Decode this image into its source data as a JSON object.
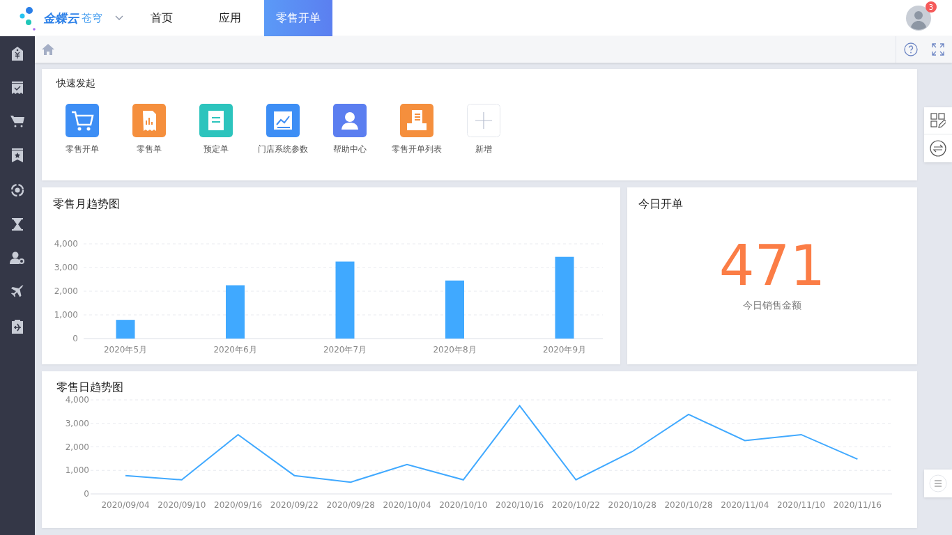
{
  "header": {
    "brand": "金蝶云",
    "brand_sub": "苍穹",
    "nav": [
      {
        "label": "首页",
        "selected": false
      },
      {
        "label": "应用",
        "selected": false
      },
      {
        "label": "零售开单",
        "selected": true
      }
    ],
    "notification_count": "3"
  },
  "quick_start": {
    "title": "快速发起",
    "items": [
      {
        "kind": "app",
        "label": "零售开单",
        "color": "#3d8ef5"
      },
      {
        "kind": "app",
        "label": "零售单",
        "color": "#f58f3d"
      },
      {
        "kind": "app",
        "label": "预定单",
        "color": "#2cc4bd"
      },
      {
        "kind": "app",
        "label": "门店系统参数",
        "color": "#3d8ef5"
      },
      {
        "kind": "app",
        "label": "帮助中心",
        "color": "#5b7ef0"
      },
      {
        "kind": "app",
        "label": "零售开单列表",
        "color": "#f58f3d"
      },
      {
        "kind": "add",
        "label": "新增"
      }
    ]
  },
  "monthly": {
    "title": "零售月趋势图",
    "chart_data": {
      "type": "bar",
      "categories": [
        "2020年5月",
        "2020年6月",
        "2020年7月",
        "2020年8月",
        "2020年9月"
      ],
      "series": [
        {
          "color": "#40a9ff",
          "values": [
            790,
            2250,
            3250,
            2450,
            3450
          ]
        }
      ],
      "grid": true,
      "ylim": [
        0,
        4000
      ],
      "yticks": [
        {
          "value": 0,
          "label": "0"
        },
        {
          "value": 1000,
          "label": "1,000"
        },
        {
          "value": 2000,
          "label": "2,000"
        },
        {
          "value": 3000,
          "label": "3,000"
        },
        {
          "value": 4000,
          "label": "4,000"
        }
      ]
    }
  },
  "today": {
    "title": "今日开单",
    "value": "471",
    "label": "今日销售金额"
  },
  "daily": {
    "title": "零售日趋势图",
    "chart_data": {
      "type": "line",
      "categories": [
        "2020/09/04",
        "2020/09/10",
        "2020/09/16",
        "2020/09/22",
        "2020/09/28",
        "2020/10/04",
        "2020/10/10",
        "2020/10/16",
        "2020/10/22",
        "2020/10/28",
        "2020/10/28",
        "2020/11/04",
        "2020/11/10",
        "2020/11/16"
      ],
      "grid": true,
      "series": [
        {
          "color": "#40a9ff",
          "values": [
            780,
            600,
            2520,
            780,
            500,
            1250,
            600,
            3750,
            600,
            1800,
            3380,
            2270,
            2520,
            1480
          ]
        }
      ],
      "ylim": [
        0,
        4000
      ],
      "yticks": [
        {
          "value": 0,
          "label": "0"
        },
        {
          "value": 1000,
          "label": "1,000"
        },
        {
          "value": 2000,
          "label": "2,000"
        },
        {
          "value": 3000,
          "label": "3,000"
        },
        {
          "value": 4000,
          "label": "4,000"
        }
      ]
    }
  }
}
